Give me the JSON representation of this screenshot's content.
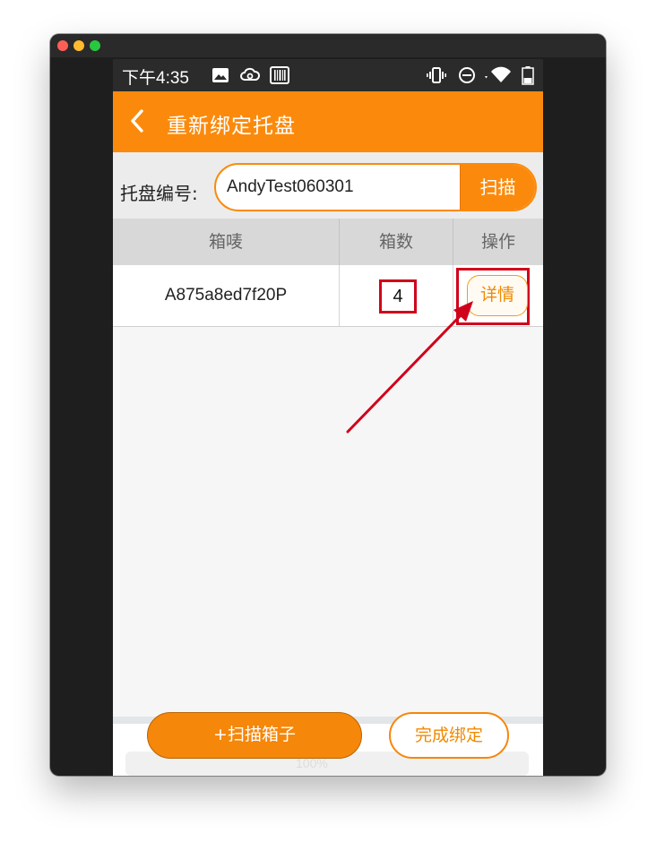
{
  "status_bar": {
    "time": "下午4:35",
    "icons": [
      "image-icon",
      "cloud-sync-icon",
      "barcode-icon",
      "vibrate-icon",
      "do-not-disturb-icon",
      "wifi-icon",
      "battery-icon"
    ]
  },
  "header": {
    "back_icon": "chevron-left-icon",
    "title": "重新绑定托盘"
  },
  "pallet": {
    "label": "托盘编号:",
    "value": "AndyTest060301",
    "scan_label": "扫描"
  },
  "table": {
    "headers": [
      "箱唛",
      "箱数",
      "操作"
    ],
    "rows": [
      {
        "mark": "A875a8ed7f20P",
        "count": "4",
        "action": "详情"
      }
    ]
  },
  "footer": {
    "scan_box_label": "+扫描箱子",
    "finish_label": "完成绑定"
  },
  "colors": {
    "accent": "#fb8a0c",
    "annotation": "#d0021b",
    "status_bar": "#2b2b2b"
  }
}
